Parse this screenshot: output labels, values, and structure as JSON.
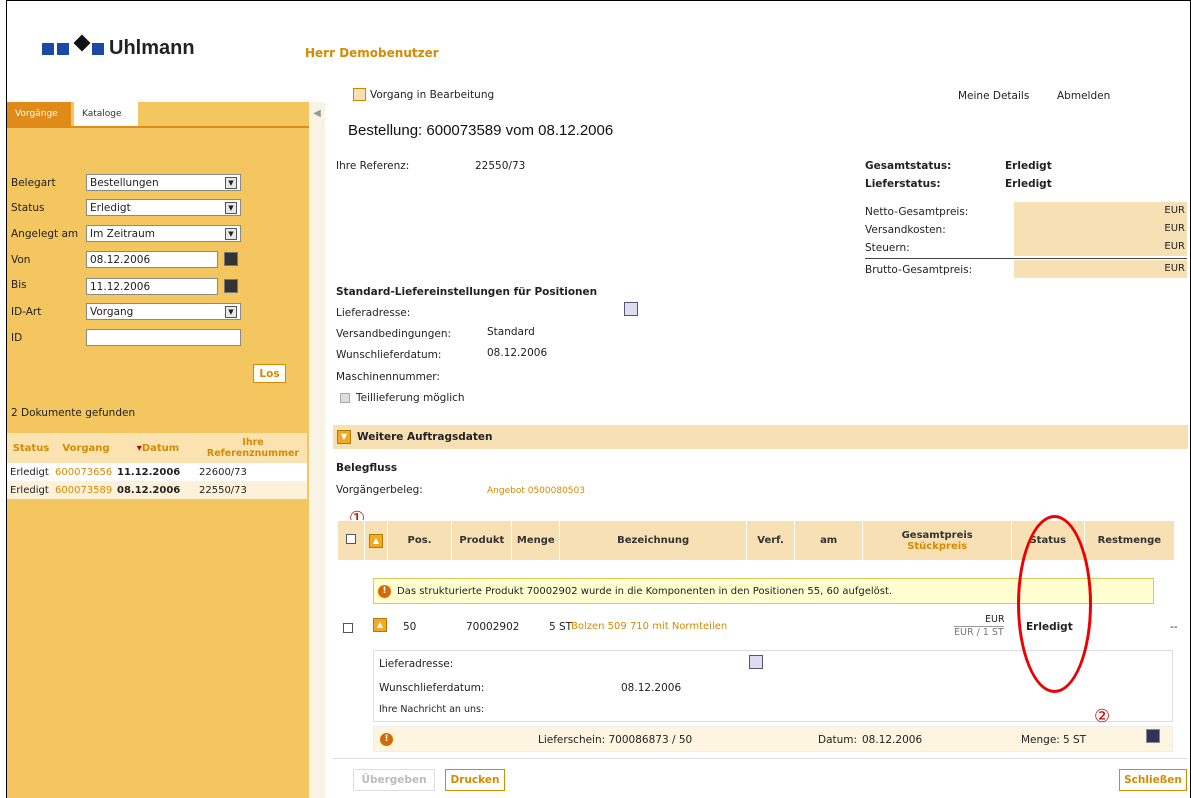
{
  "header": {
    "brand": "Uhlmann",
    "user": "Herr Demobenutzer"
  },
  "sidebar": {
    "tabs": [
      "Vorgänge",
      "Kataloge"
    ],
    "filters": [
      {
        "label": "Belegart",
        "value": "Bestellungen"
      },
      {
        "label": "Status",
        "value": "Erledigt"
      },
      {
        "label": "Angelegt am",
        "value": "Im Zeitraum"
      },
      {
        "label": "Von",
        "value": "08.12.2006"
      },
      {
        "label": "Bis",
        "value": "11.12.2006"
      },
      {
        "label": "ID-Art",
        "value": "Vorgang"
      },
      {
        "label": "ID",
        "value": ""
      }
    ],
    "go_label": "Los",
    "found_text": "2 Dokumente gefunden",
    "results_headers": [
      "Status",
      "Vorgang",
      "Datum",
      "Ihre Referenznummer"
    ],
    "results": [
      [
        "Erledigt",
        "600073656",
        "11.12.2006",
        "22600/73"
      ],
      [
        "Erledigt",
        "600073589",
        "08.12.2006",
        "22550/73"
      ]
    ]
  },
  "main": {
    "status_line": "Vorgang in Bearbeitung",
    "links": [
      "Meine Details",
      "Abmelden"
    ],
    "title": "Bestellung: 600073589 vom 08.12.2006",
    "ref_label": "Ihre Referenz:",
    "ref_value": "22550/73",
    "gesamtstatus_label": "Gesamtstatus:",
    "gesamtstatus_value": "Erledigt",
    "lieferstatus_label": "Lieferstatus:",
    "lieferstatus_value": "Erledigt",
    "summary": [
      {
        "label": "Netto-Gesamtpreis:",
        "value": "EUR"
      },
      {
        "label": "Versandkosten:",
        "value": "EUR"
      },
      {
        "label": "Steuern:",
        "value": "EUR"
      },
      {
        "label": "Brutto-Gesamtpreis:",
        "value": "EUR"
      }
    ],
    "std_title": "Standard-Liefereinstellungen für Positionen",
    "std_rows": [
      {
        "label": "Lieferadresse:",
        "value": ""
      },
      {
        "label": "Versandbedingungen:",
        "value": "Standard"
      },
      {
        "label": "Wunschlieferdatum:",
        "value": "08.12.2006"
      },
      {
        "label": "Maschinennummer:",
        "value": ""
      }
    ],
    "teillieferung": "Teillieferung möglich",
    "section_title": "Weitere Auftragsdaten",
    "belegfluss_title": "Belegfluss",
    "vorg_label": "Vorgängerbeleg:",
    "vorg_value": "Angebot 0500080503",
    "table_headers": [
      "Pos.",
      "Produkt",
      "Menge",
      "Bezeichnung",
      "Verf.",
      "am",
      "Gesamtpreis",
      "Stückpreis",
      "Status",
      "Restmenge"
    ],
    "notice": "Das strukturierte Produkt 70002902 wurde in die Komponenten in den Positionen 55, 60 aufgelöst.",
    "row": {
      "pos": "50",
      "produkt": "70002902",
      "menge": "5 ST",
      "bez": "Bolzen 509 710 mit Normteilen",
      "preis": "EUR",
      "stueck": "EUR / 1 ST",
      "status": "Erledigt",
      "rest": "--"
    },
    "detail": [
      {
        "label": "Lieferadresse:",
        "value": ""
      },
      {
        "label": "Wunschlieferdatum:",
        "value": "08.12.2006"
      },
      {
        "label": "Ihre Nachricht an uns:",
        "value": ""
      }
    ],
    "delivery": {
      "lieferschein": "Lieferschein: 700086873 / 50",
      "datum_label": "Datum:",
      "datum": "08.12.2006",
      "menge_label": "Menge:",
      "menge": "5 ST"
    },
    "annotations": [
      "①",
      "②"
    ],
    "buttons": {
      "uebergeben": "Übergeben",
      "drucken": "Drucken",
      "schliessen": "Schließen"
    }
  }
}
